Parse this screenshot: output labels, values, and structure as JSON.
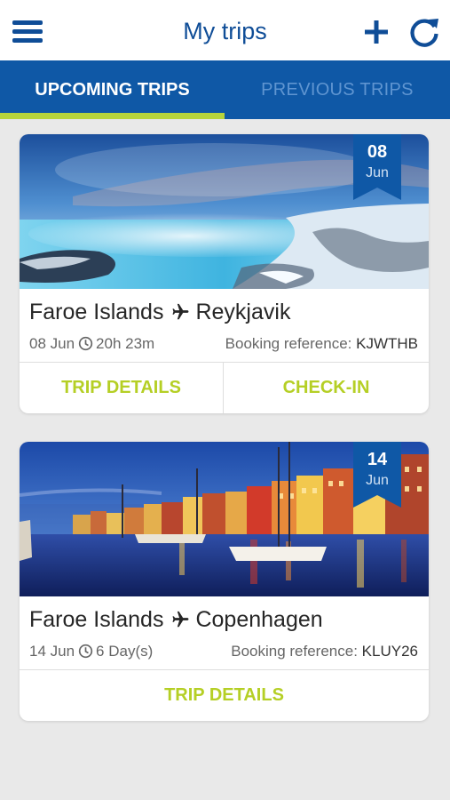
{
  "header": {
    "title": "My trips",
    "icons": {
      "menu": "hamburger-menu-icon",
      "add": "plus-icon",
      "refresh": "refresh-icon"
    }
  },
  "tabs": [
    {
      "label": "UPCOMING TRIPS",
      "active": true
    },
    {
      "label": "PREVIOUS TRIPS",
      "active": false
    }
  ],
  "trips": [
    {
      "day": "08",
      "month": "Jun",
      "from": "Faroe Islands",
      "to": "Reykjavik",
      "date": "08 Jun",
      "duration": "20h 23m",
      "booking_label": "Booking reference:",
      "booking_ref": "KJWTHB",
      "actions": [
        "TRIP DETAILS",
        "CHECK-IN"
      ]
    },
    {
      "day": "14",
      "month": "Jun",
      "from": "Faroe Islands",
      "to": "Copenhagen",
      "date": "14 Jun",
      "duration": "6 Day(s)",
      "booking_label": "Booking reference:",
      "booking_ref": "KLUY26",
      "actions": [
        "TRIP DETAILS"
      ]
    }
  ],
  "colors": {
    "primary": "#0f4d97",
    "tab_bar": "#0f58a6",
    "accent": "#b5cf25",
    "background": "#e9e9e9"
  }
}
